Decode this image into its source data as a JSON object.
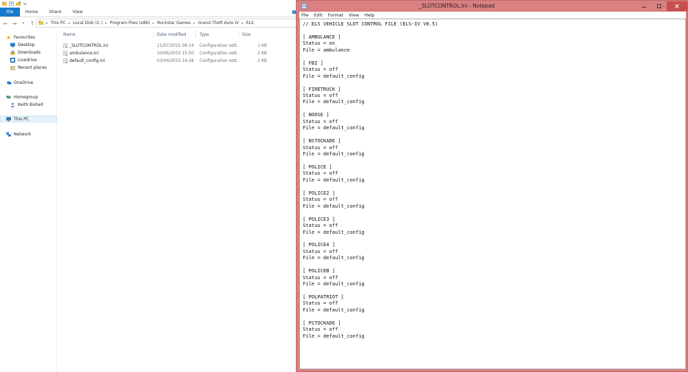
{
  "explorer": {
    "ribbon": {
      "tabs": [
        "File",
        "Home",
        "Share",
        "View"
      ]
    },
    "address": {
      "crumbs": [
        "This PC",
        "Local Disk (C:)",
        "Program Files (x86)",
        "Rockstar Games",
        "Grand Theft Auto IV",
        "ELS"
      ]
    },
    "sidebar": {
      "favourites": "Favourites",
      "desktop": "Desktop",
      "downloads": "Downloads",
      "livedrive": "Livedrive",
      "recent": "Recent places",
      "onedrive": "OneDrive",
      "homegroup": "Homegroup",
      "user": "Keith Bishell",
      "thispc": "This PC",
      "network": "Network"
    },
    "columns": {
      "name": "Name",
      "date": "Date modified",
      "type": "Type",
      "size": "Size"
    },
    "files": [
      {
        "name": "_SLOTCONTROL.ini",
        "date": "11/07/2015 09:14",
        "type": "Configuration sett...",
        "size": "1 KB"
      },
      {
        "name": "ambulance.ini",
        "date": "10/06/2015 15:50",
        "type": "Configuration sett...",
        "size": "2 KB"
      },
      {
        "name": "default_config.ini",
        "date": "03/04/2015 14:28",
        "type": "Configuration sett...",
        "size": "2 KB"
      }
    ]
  },
  "notepad": {
    "title": "_SLOTCONTROL.ini - Notepad",
    "menu": [
      "File",
      "Edit",
      "Format",
      "View",
      "Help"
    ],
    "content": "// ELS VEHICLE SLOT CONTROL FILE (ELS-IV V8.5)\n\n[ AMBULANCE ]\nStatus = on\nFile = ambulance\n\n[ FBI ]\nStatus = off\nFile = default_config\n\n[ FIRETRUCK ]\nStatus = off\nFile = default_config\n\n[ NOOSE ]\nStatus = off\nFile = default_config\n\n[ NSTOCKADE ]\nStatus = off\nFile = default_config\n\n[ POLICE ]\nStatus = off\nFile = default_config\n\n[ POLICE2 ]\nStatus = off\nFile = default_config\n\n[ POLICE3 ]\nStatus = off\nFile = default_config\n\n[ POLICE4 ]\nStatus = off\nFile = default_config\n\n[ POLICEB ]\nStatus = off\nFile = default_config\n\n[ POLPATRIOT ]\nStatus = off\nFile = default_config\n\n[ PSTOCKADE ]\nStatus = off\nFile = default_config"
  }
}
